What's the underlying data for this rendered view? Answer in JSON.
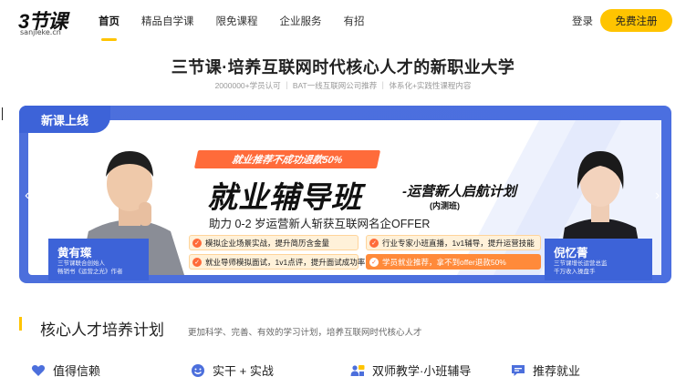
{
  "header": {
    "logo_main": "3节课",
    "logo_sub": "sanjieke.cn",
    "nav": [
      {
        "label": "首页",
        "active": true
      },
      {
        "label": "精品自学课",
        "active": false
      },
      {
        "label": "限免课程",
        "active": false
      },
      {
        "label": "企业服务",
        "active": false
      },
      {
        "label": "有招",
        "active": false
      }
    ],
    "login": "登录",
    "register": "免费注册"
  },
  "hero": {
    "title": "三节课·培养互联网时代核心人才的新职业大学",
    "subtitle": "2000000+学员认可 ｜ BAT一线互联网公司推荐 ｜ 体系化+实践性课程内容"
  },
  "banner": {
    "tag": "新课上线",
    "ribbon": "就业推荐不成功退款50%",
    "heading": "就业辅导班",
    "heading2": "-运营新人启航计划",
    "heading3": "(内测班)",
    "line": "助力 0-2 岁运营新人斩获互联网名企OFFER",
    "features": [
      {
        "text": "模拟企业场景实战，提升简历含金量",
        "highlight": false
      },
      {
        "text": "行业专家小班直播，1v1辅导，提升运营技能",
        "highlight": false
      },
      {
        "text": "就业导师模拟面试，1v1点评，提升面试成功率",
        "highlight": false
      },
      {
        "text": "学员就业推荐，拿不到offer退款50%",
        "highlight": true
      }
    ],
    "left_person": {
      "name": "黄有璨",
      "desc1": "三节课联合创始人",
      "desc2": "畅销书《运营之光》作者"
    },
    "right_person": {
      "name": "倪忆菁",
      "desc1": "三节课增长运营总监",
      "desc2": "千万收入操盘手"
    },
    "watermark": "SANJIE"
  },
  "section": {
    "title": "核心人才培养计划",
    "desc": "更加科学、完善、有效的学习计划，培养互联网时代核心人才",
    "features": [
      {
        "label": "值得信赖",
        "icon": "heart-icon"
      },
      {
        "label": "实干 + 实战",
        "icon": "smile-icon"
      },
      {
        "label": "双师教学·小班辅导",
        "icon": "teachers-icon"
      },
      {
        "label": "推荐就业",
        "icon": "chat-icon"
      }
    ]
  },
  "colors": {
    "accent": "#ffc400",
    "banner_blue": "#4b6fe0",
    "orange": "#ff6b3a"
  }
}
